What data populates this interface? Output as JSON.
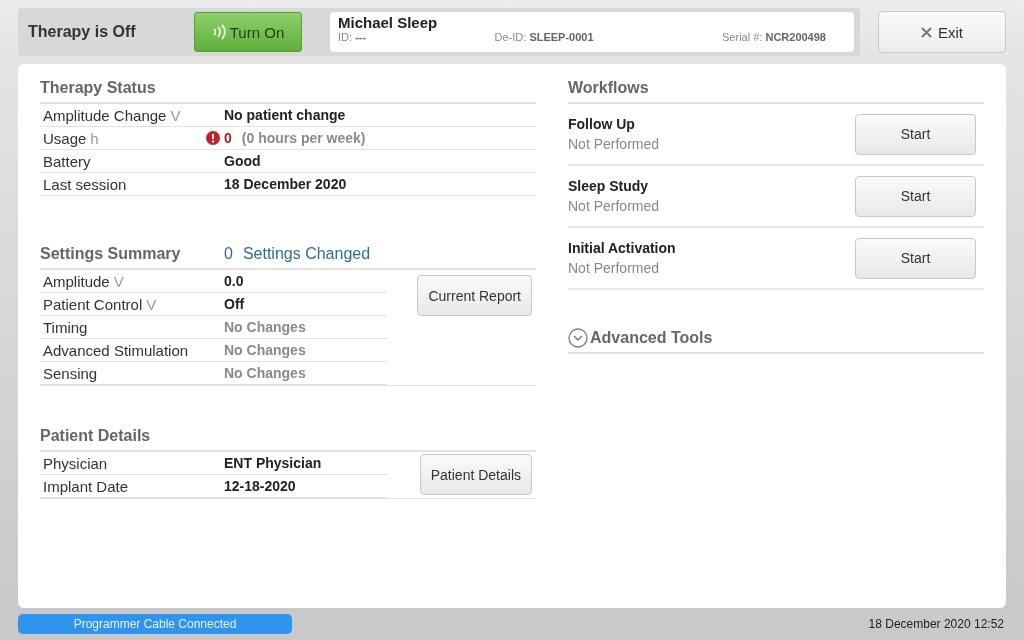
{
  "header": {
    "therapy_status": "Therapy is Off",
    "turn_on_button": "Turn On",
    "patient": {
      "name": "Michael Sleep",
      "fields": [
        {
          "label": "ID:",
          "value": "---"
        },
        {
          "label": "De-ID:",
          "value": "SLEEP-0001"
        },
        {
          "label": "Serial #:",
          "value": "NCR200498"
        }
      ]
    },
    "exit_button": "Exit"
  },
  "therapy_status": {
    "title": "Therapy Status",
    "rows": [
      {
        "label": "Amplitude Change",
        "unit": "V",
        "value": "No patient change",
        "kind": "bold",
        "alert": false
      },
      {
        "label": "Usage",
        "unit": "h",
        "value": "0",
        "note": "(0 hours per week)",
        "kind": "bold",
        "alert": true
      },
      {
        "label": "Battery",
        "value": "Good",
        "kind": "bold",
        "alert": false
      },
      {
        "label": "Last session",
        "value": "18 December 2020",
        "kind": "bold",
        "alert": false
      }
    ]
  },
  "settings_summary": {
    "title": "Settings Summary",
    "changed_count": "0",
    "changed_label": "Settings Changed",
    "button": "Current Report",
    "rows": [
      {
        "label": "Amplitude",
        "unit": "V",
        "value": "0.0",
        "kind": "bold"
      },
      {
        "label": "Patient Control",
        "unit": "V",
        "value": "Off",
        "kind": "bold"
      },
      {
        "label": "Timing",
        "value": "No Changes",
        "kind": "muted"
      },
      {
        "label": "Advanced Stimulation",
        "value": "No Changes",
        "kind": "muted"
      },
      {
        "label": "Sensing",
        "value": "No Changes",
        "kind": "muted"
      }
    ]
  },
  "patient_details": {
    "title": "Patient Details",
    "button": "Patient Details",
    "rows": [
      {
        "label": "Physician",
        "value": "ENT Physician",
        "kind": "bold"
      },
      {
        "label": "Implant Date",
        "value": "12-18-2020",
        "kind": "bold"
      }
    ]
  },
  "workflows": {
    "title": "Workflows",
    "items": [
      {
        "name": "Follow Up",
        "status": "Not Performed",
        "button": "Start"
      },
      {
        "name": "Sleep Study",
        "status": "Not Performed",
        "button": "Start"
      },
      {
        "name": "Initial Activation",
        "status": "Not Performed",
        "button": "Start"
      }
    ],
    "advanced_tools": {
      "label": "Advanced Tools",
      "expanded": false
    }
  },
  "status_bar": {
    "connection": "Programmer Cable Connected",
    "datetime": "18 December 2020 12:52"
  }
}
